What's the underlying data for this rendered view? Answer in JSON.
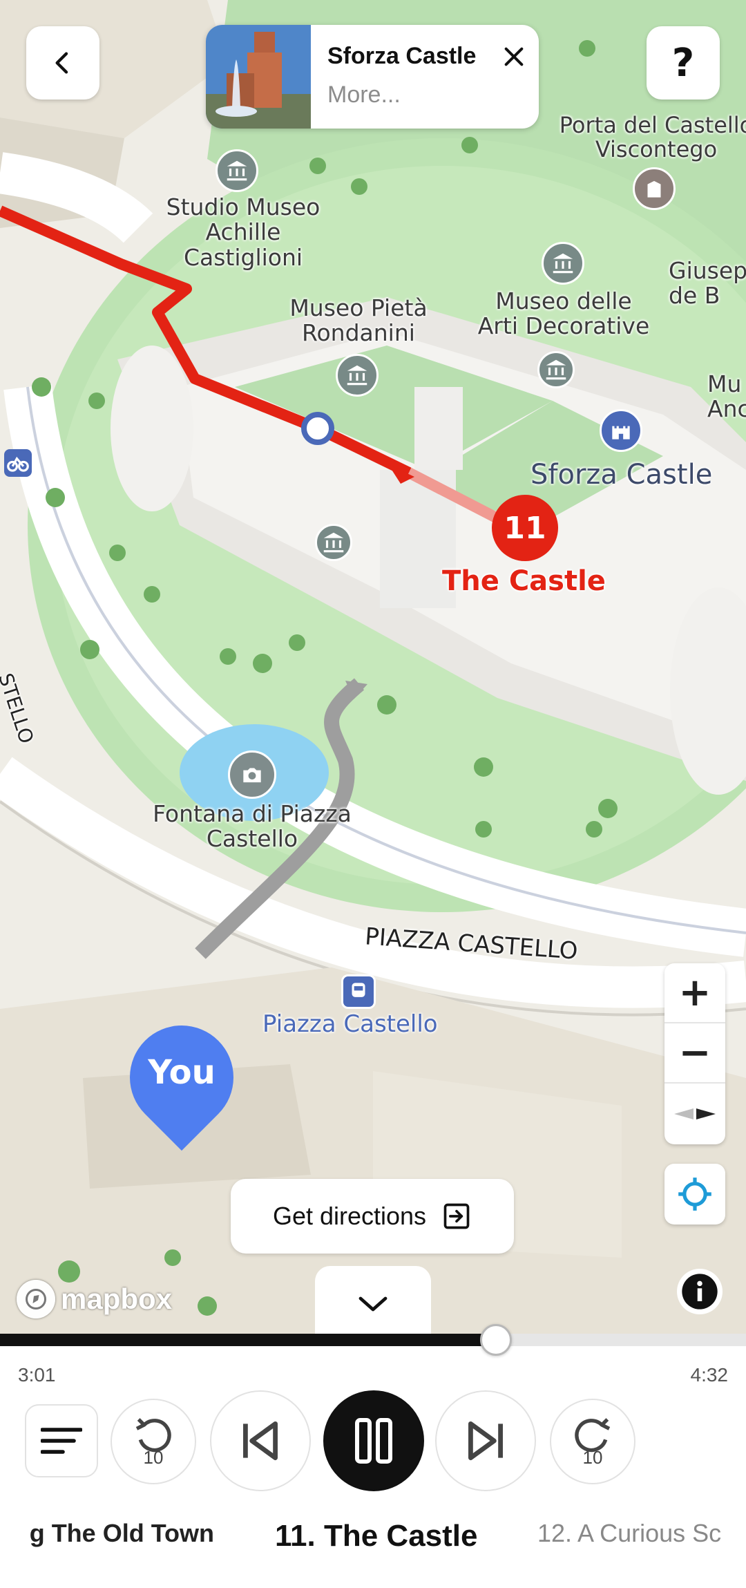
{
  "header": {
    "back_label": "<",
    "help_label": "?",
    "place_card": {
      "title": "Sforza Castle",
      "subtitle": "More..."
    }
  },
  "map": {
    "labels": {
      "porta": "Porta del Castello Viscontego",
      "studio": "Studio Museo Achille Castiglioni",
      "museo_pieta": "Museo Pietà Rondanini",
      "museo_arti": "Museo delle Arti Decorative",
      "giusep": "Giusep de B",
      "mu": "Mu Anc",
      "sforza": "Sforza Castle",
      "fontana": "Fontana di Piazza Castello",
      "piazza_street": "PIAZZA CASTELLO",
      "piazza_stop": "Piazza Castello",
      "stello": "STELLO"
    },
    "route_stop_number": "11",
    "route_stop_label": "The Castle",
    "you_label": "You",
    "route_color": "#e32314",
    "you_color": "#4f7ef0"
  },
  "controls": {
    "zoom_in": "+",
    "zoom_out": "−",
    "directions_label": "Get directions",
    "attribution_label": "mapbox"
  },
  "player": {
    "elapsed": "3:01",
    "duration": "4:32",
    "progress_fraction": 0.665,
    "skip_back_seconds": "10",
    "skip_forward_seconds": "10",
    "tracks": {
      "previous": "g The Old Town",
      "current": "11. The Castle",
      "next": "12. A Curious Sc"
    }
  }
}
